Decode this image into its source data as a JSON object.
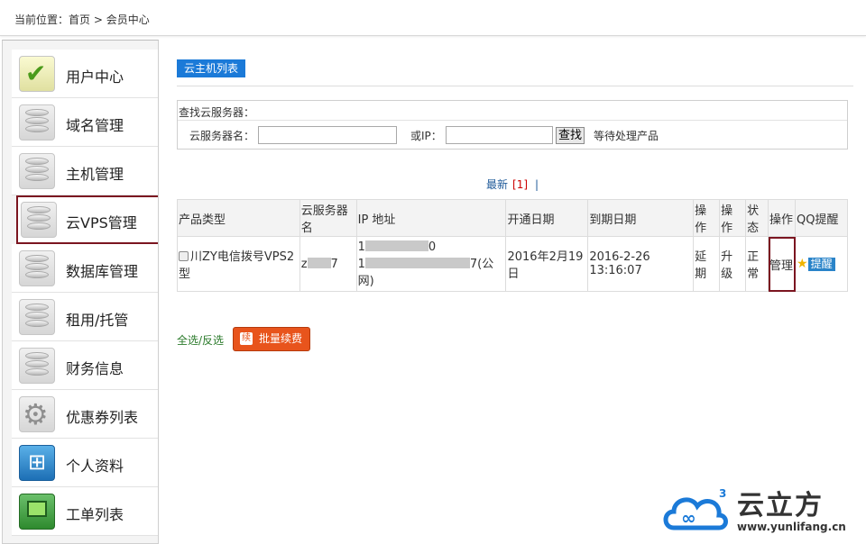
{
  "breadcrumb": {
    "prefix": "当前位置：",
    "home": "首页",
    "separator": ">",
    "current": "会员中心"
  },
  "sidebar": {
    "items": [
      {
        "label": "用户中心",
        "icon": "check-icon"
      },
      {
        "label": "域名管理",
        "icon": "database-icon"
      },
      {
        "label": "主机管理",
        "icon": "database-icon"
      },
      {
        "label": "云VPS管理",
        "icon": "database-icon",
        "active": true
      },
      {
        "label": "数据库管理",
        "icon": "database-icon"
      },
      {
        "label": "租用/托管",
        "icon": "database-icon"
      },
      {
        "label": "财务信息",
        "icon": "database-icon"
      },
      {
        "label": "优惠券列表",
        "icon": "gear-icon"
      },
      {
        "label": "个人资料",
        "icon": "org-chart-icon"
      },
      {
        "label": "工单列表",
        "icon": "ticket-icon"
      }
    ]
  },
  "main": {
    "section_title": "云主机列表",
    "search": {
      "title": "查找云服务器：",
      "name_label": "云服务器名：",
      "ip_label": "或IP：",
      "find_button": "查找",
      "pending_label": "等待处理产品"
    },
    "pager": {
      "newest": "最新",
      "page": "[1]",
      "sep": "|"
    },
    "table": {
      "headers": [
        "产品类型",
        "云服务器名",
        "IP 地址",
        "开通日期",
        "到期日期",
        "操作",
        "操作",
        "状态",
        "操作",
        "QQ提醒"
      ],
      "rows": [
        {
          "product": "川ZY电信拨号VPS2型",
          "server_prefix": "z",
          "server_suffix": "7",
          "ip1_prefix": "1",
          "ip1_suffix": "0",
          "ip2_prefix": "1",
          "ip2_suffix": "7(公网)",
          "open_date": "2016年2月19日",
          "expire_date": "2016-2-26 13:16:07",
          "renew": "延期",
          "upgrade": "升级",
          "status": "正常",
          "manage": "管理",
          "remind": "提醒"
        }
      ]
    },
    "bottom": {
      "select_all": "全选/反选",
      "batch_renew": "批量续费"
    }
  },
  "watermark": {
    "brand": "云立方",
    "url": "www.yunlifang.cn"
  },
  "colors": {
    "accent": "#1b7ad8",
    "active_border": "#7b1520",
    "batch_button": "#e8541c"
  }
}
